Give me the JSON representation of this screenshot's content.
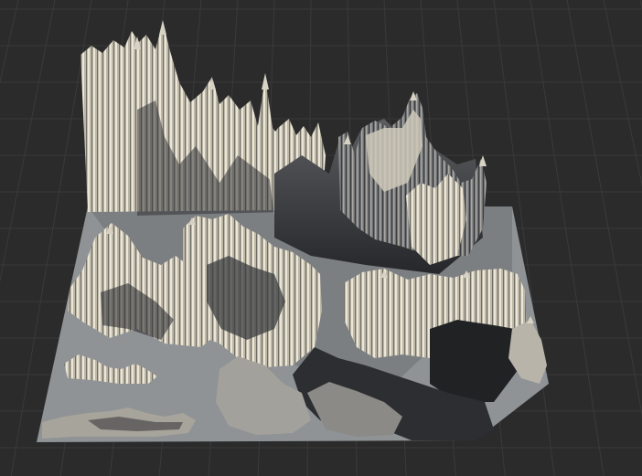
{
  "viewport": {
    "background_color": "#2b2b2b",
    "grid_color": "#3a3a3a",
    "grid_visible": true
  },
  "terrain": {
    "object_kind": "heightmap-terrain-mesh",
    "base_color": "#9a9d9f",
    "highlight_color": "#d8d2c4",
    "shadow_color": "#2e3033"
  }
}
